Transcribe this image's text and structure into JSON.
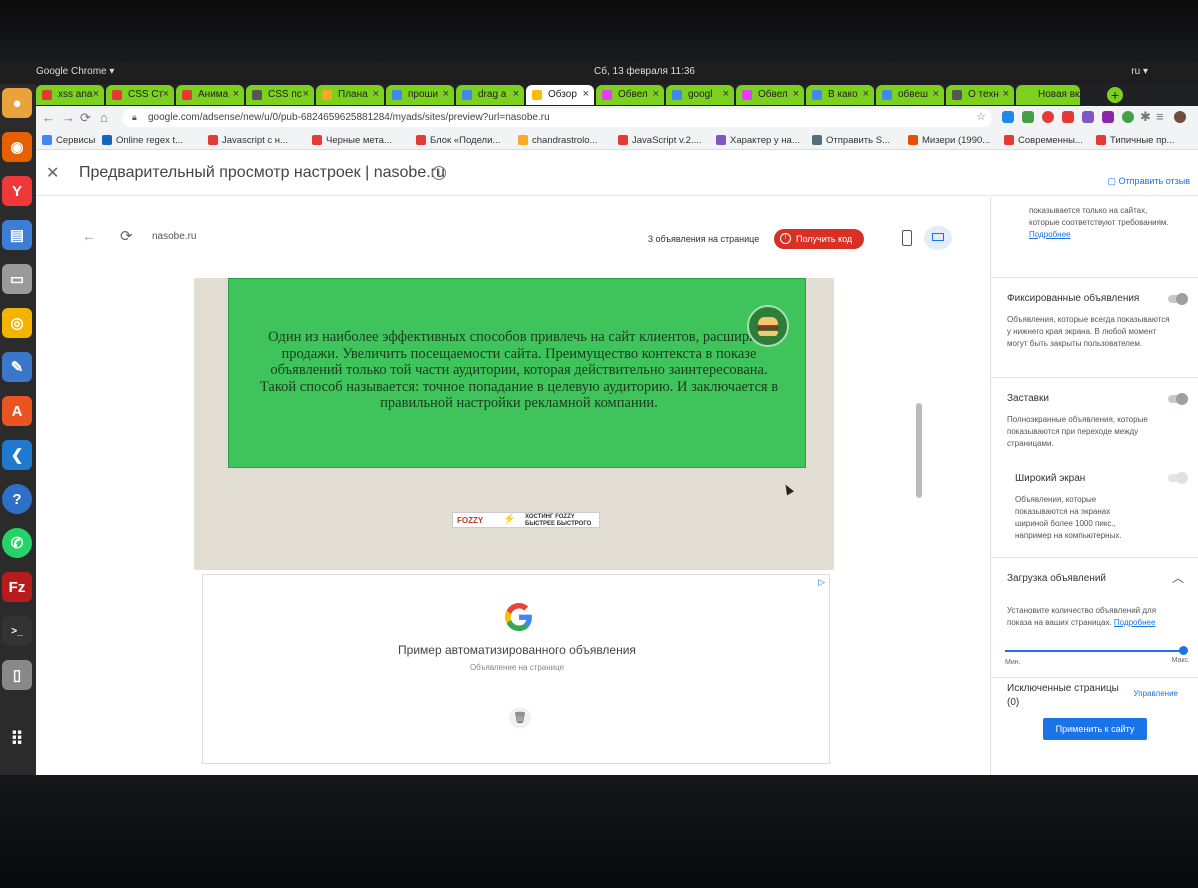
{
  "system": {
    "app_name": "Google Chrome ▾",
    "clock": "Сб, 13 февраля  11:36",
    "language": "ru ▾"
  },
  "tabs": [
    {
      "label": "xss ana",
      "color": "#7bd11e",
      "fav": "#e53935"
    },
    {
      "label": "CSS Ст",
      "color": "#7bd11e",
      "fav": "#e53935"
    },
    {
      "label": "Анима",
      "color": "#7bd11e",
      "fav": "#e53935"
    },
    {
      "label": "CSS пс",
      "color": "#7bd11e",
      "fav": "#555555"
    },
    {
      "label": "Плана",
      "color": "#7bd11e",
      "fav": "#f9a825"
    },
    {
      "label": "проши",
      "color": "#7bd11e",
      "fav": "#4285f4"
    },
    {
      "label": "drag a",
      "color": "#7bd11e",
      "fav": "#4285f4"
    },
    {
      "label": "Обзор",
      "color": "#ffffff",
      "fav": "#fbbc05"
    },
    {
      "label": "Обвел",
      "color": "#7bd11e",
      "fav": "#e040fb"
    },
    {
      "label": "googl",
      "color": "#7bd11e",
      "fav": "#4285f4"
    },
    {
      "label": "Обвел",
      "color": "#7bd11e",
      "fav": "#e040fb"
    },
    {
      "label": "В како",
      "color": "#7bd11e",
      "fav": "#4285f4"
    },
    {
      "label": "обвеш",
      "color": "#7bd11e",
      "fav": "#4285f4"
    },
    {
      "label": "О техн",
      "color": "#7bd11e",
      "fav": "#555555"
    },
    {
      "label": "Новая вкл",
      "color": "#7bd11e",
      "fav": "#7bd11e"
    }
  ],
  "omnibox": {
    "url": "google.com/adsense/new/u/0/pub-6824659625881284/myads/sites/preview?url=nasobe.ru"
  },
  "bookmarks": [
    {
      "label": "Сервисы",
      "fav": "#4285f4"
    },
    {
      "label": "Online regex t...",
      "fav": "#1565c0"
    },
    {
      "label": "Javascript с н...",
      "fav": "#e53935"
    },
    {
      "label": "Черные мета...",
      "fav": "#e53935"
    },
    {
      "label": "Блок «Подели...",
      "fav": "#e53935"
    },
    {
      "label": "chandrastrolo...",
      "fav": "#f9a825"
    },
    {
      "label": "JavaScript v.2....",
      "fav": "#e53935"
    },
    {
      "label": "Характер у на...",
      "fav": "#7e57c2"
    },
    {
      "label": "Отправить S...",
      "fav": "#546e7a"
    },
    {
      "label": "Мизери (1990...",
      "fav": "#e65100"
    },
    {
      "label": "Современны...",
      "fav": "#e53935"
    },
    {
      "label": "Типичные пр...",
      "fav": "#e53935"
    }
  ],
  "header": {
    "title": "Предварительный просмотр настроек | nasobe.ru",
    "feedback": "Отправить отзыв"
  },
  "preview": {
    "domain": "nasobe.ru",
    "ad_count": "3 объявления на странице",
    "get_code": "Получить код",
    "banner_text": "Один из наиболее эффективных способов привлечь на сайт клиентов, расширить продажи. Увеличить посещаемости сайта. Преимущество контекста в показе объявлений только той части аудитории, которая действительно заинтересована. Такой способ называется: точное попадание в целевую аудиторию. И заключается в правильной настройки рекламной компании.",
    "fozzy_logo": "FOZZY",
    "fozzy_slogan": "ХОСТИНГ FOZZY БЫСТРЕЕ БЫСТРОГО",
    "auto_ad_title": "Пример автоматизированного объявления",
    "auto_ad_sub": "Объявление на странице"
  },
  "settings": {
    "top_desc": "показывается только на сайтах, которые соответствуют требованиям.",
    "more_link": "Подробнее",
    "anchor_title": "Фиксированные объявления",
    "anchor_desc": "Объявления, которые всегда показываются у нижнего края экрана. В любой момент могут быть закрыты пользователем.",
    "vignette_title": "Заставки",
    "vignette_desc": "Полноэкранные объявления, которые показываются при переходе между страницами.",
    "wide_title": "Широкий экран",
    "wide_desc": "Объявления, которые показываются на экранах шириной более 1000 пикс., например на компьютерных.",
    "load_title": "Загрузка объявлений",
    "load_desc": "Установите количество объявлений для показа на ваших страницах.",
    "load_link": "Подробнее",
    "slider_min": "Мин.",
    "slider_max": "Макс.",
    "slider_value": 1.0,
    "excluded_title": "Исключенные страницы",
    "excluded_count": "(0)",
    "manage": "Управление",
    "apply": "Применить к сайту"
  }
}
